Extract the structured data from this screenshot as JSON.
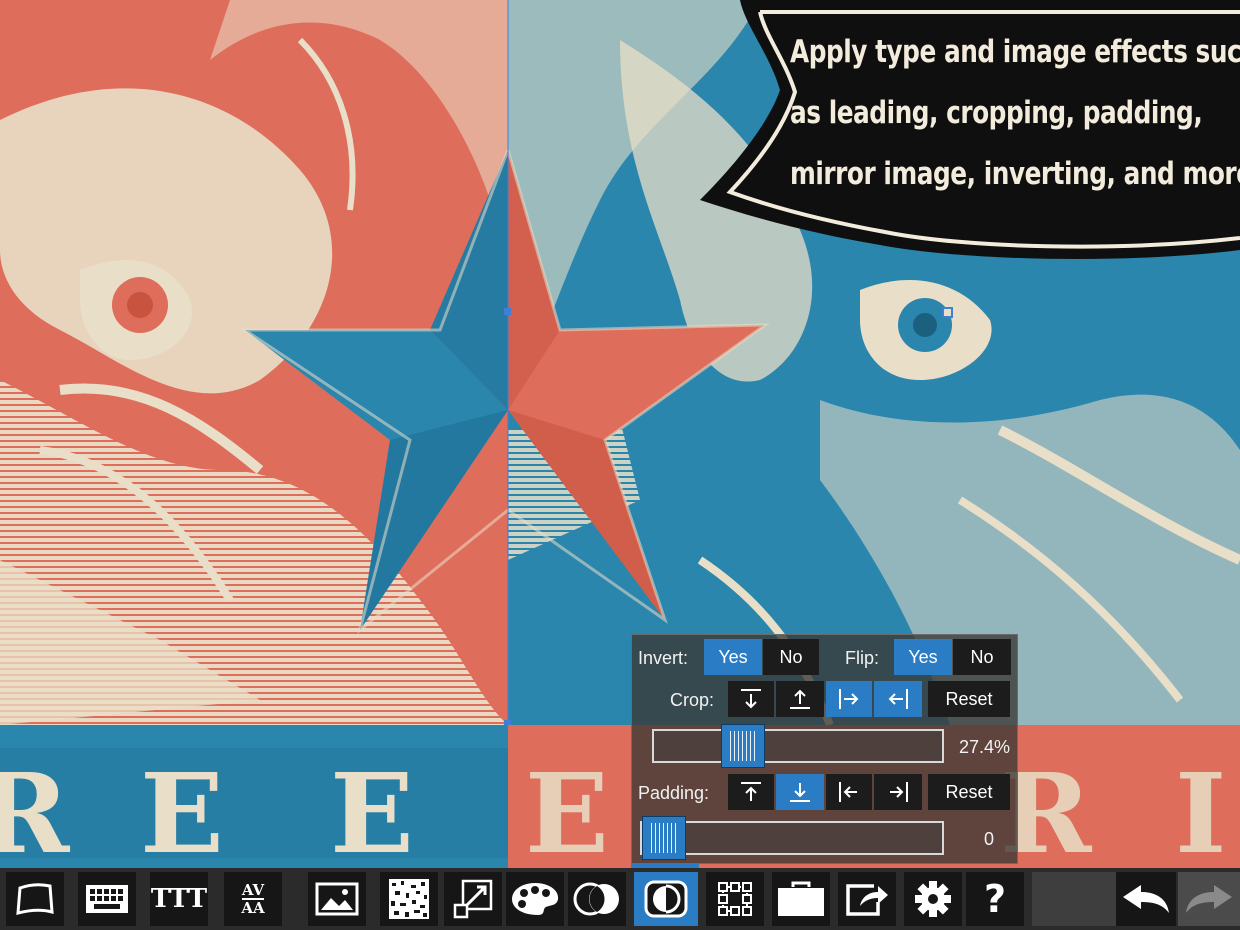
{
  "callout": {
    "lines": [
      "Apply type and image effects such",
      "as leading, cropping, padding,",
      "mirror image, inverting, and more."
    ]
  },
  "artwork": {
    "banner_left_letters": [
      "R",
      "E",
      "E"
    ],
    "banner_right_letters": [
      "E",
      "R",
      "I"
    ],
    "colors": {
      "red": "#df6d5c",
      "blue": "#2a86ad",
      "cream": "#e9dfc8",
      "navy": "#1f6f98"
    }
  },
  "effects": {
    "invert_label": "Invert:",
    "invert_yes": "Yes",
    "invert_no": "No",
    "flip_label": "Flip:",
    "flip_yes": "Yes",
    "flip_no": "No",
    "crop_label": "Crop:",
    "crop_reset": "Reset",
    "crop_value": "27.4%",
    "crop_fraction": 0.274,
    "padding_label": "Padding:",
    "padding_reset": "Reset",
    "padding_value": "0",
    "padding_fraction": 0
  },
  "toolbar": {
    "tools": [
      "frame-icon",
      "keyboard-icon",
      "text-size-icon",
      "kerning-icon",
      "image-icon",
      "texture-icon",
      "resize-icon",
      "palette-icon",
      "blend-icon",
      "effects-icon",
      "transform-icon",
      "briefcase-icon",
      "share-icon",
      "settings-icon",
      "help-icon"
    ],
    "help_label": "?",
    "text_size_label": "TTT",
    "kerning_top": "AV",
    "kerning_bottom": "AA",
    "accent": "#2a7cc4"
  }
}
